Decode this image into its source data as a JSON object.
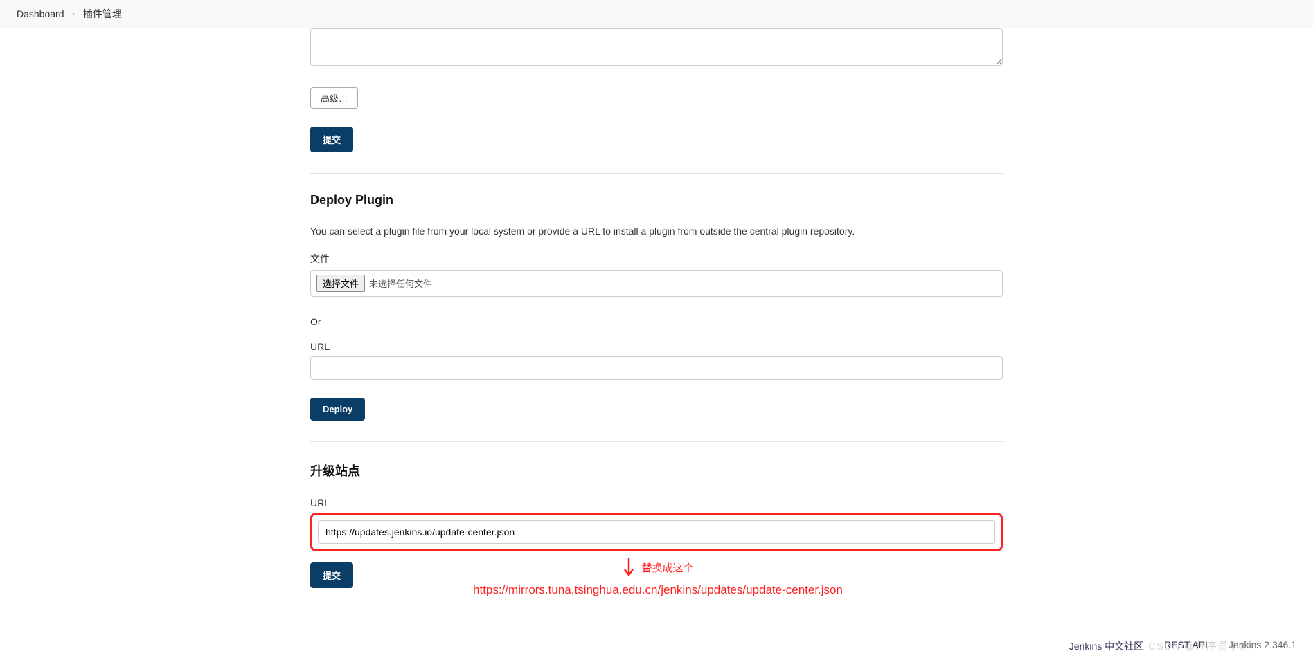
{
  "breadcrumb": {
    "items": [
      "Dashboard",
      "插件管理"
    ]
  },
  "top": {
    "advanced_btn": "高级…",
    "submit_btn": "提交"
  },
  "deploy": {
    "title": "Deploy Plugin",
    "desc": "You can select a plugin file from your local system or provide a URL to install a plugin from outside the central plugin repository.",
    "file_label": "文件",
    "file_btn": "选择文件",
    "file_status": "未选择任何文件",
    "or_label": "Or",
    "url_label": "URL",
    "url_value": "",
    "deploy_btn": "Deploy"
  },
  "upgrade": {
    "title": "升级站点",
    "url_label": "URL",
    "url_value": "https://updates.jenkins.io/update-center.json",
    "submit_btn": "提交"
  },
  "annotation": {
    "label": "替换成这个",
    "url": "https://mirrors.tuna.tsinghua.edu.cn/jenkins/updates/update-center.json"
  },
  "footer": {
    "community": "Jenkins 中文社区",
    "rest_api": "REST API",
    "version": "Jenkins 2.346.1"
  },
  "watermark": "CSDN @程序员小例"
}
